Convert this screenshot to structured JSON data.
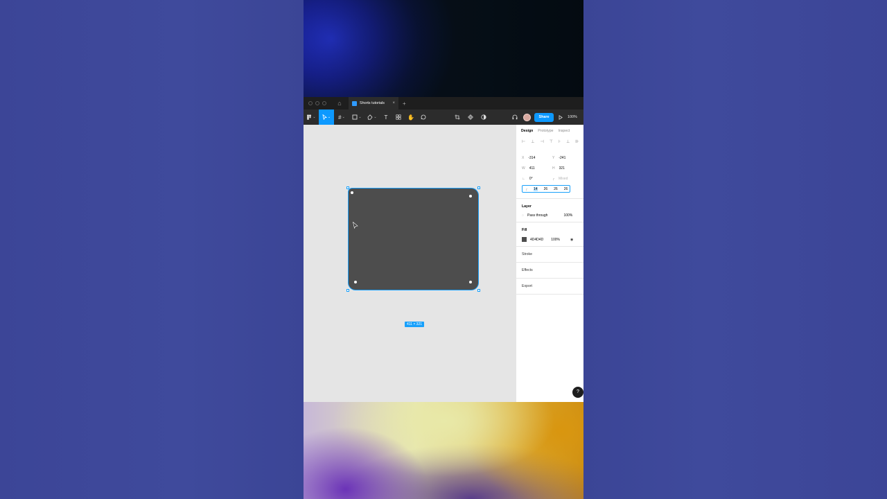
{
  "app": {
    "tab_label": "Shorts tutorials",
    "tab_close": "×",
    "tab_add": "+",
    "share_label": "Share",
    "zoom_label": "100%"
  },
  "toolbar": {
    "icons": [
      "main-menu-icon",
      "move-tool-icon",
      "frame-tool-icon",
      "shape-tool-icon",
      "pen-tool-icon",
      "text-tool-icon",
      "resources-icon",
      "hand-tool-icon",
      "comment-tool-icon",
      "crop-icon",
      "component-icon",
      "contrast-icon",
      "headphones-icon",
      "play-icon"
    ]
  },
  "canvas": {
    "shape_size_label": "411 × 321",
    "shape_fill_color": "#4D4D4D",
    "selection_color": "#18A0FB"
  },
  "panel": {
    "tabs": [
      "Design",
      "Prototype",
      "Inspect"
    ],
    "active_tab": "Design",
    "x_label": "X",
    "x_value": "-314",
    "y_label": "Y",
    "y_value": "-241",
    "w_label": "W",
    "w_value": "411",
    "h_label": "H",
    "h_value": "321",
    "rotation_value": "0°",
    "corner_value": "Mixed",
    "radius_values": [
      "14",
      "26",
      "26",
      "26"
    ],
    "layer_title": "Layer",
    "blend_mode": "Pass through",
    "layer_opacity": "100%",
    "fill_title": "Fill",
    "fill_hex": "4D4D4D",
    "fill_opacity": "100%",
    "stroke_title": "Stroke",
    "effects_title": "Effects",
    "export_title": "Export",
    "help_label": "?"
  }
}
